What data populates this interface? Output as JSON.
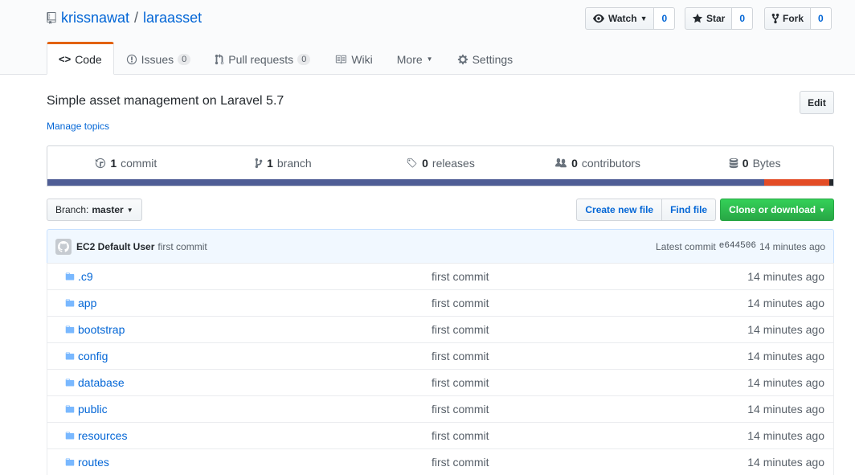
{
  "repo": {
    "owner": "krissnawat",
    "separator": "/",
    "name": "laraasset"
  },
  "actions": {
    "watch": {
      "label": "Watch",
      "count": "0"
    },
    "star": {
      "label": "Star",
      "count": "0"
    },
    "fork": {
      "label": "Fork",
      "count": "0"
    }
  },
  "nav": {
    "code": "Code",
    "issues": "Issues",
    "issues_count": "0",
    "pulls": "Pull requests",
    "pulls_count": "0",
    "wiki": "Wiki",
    "more": "More",
    "settings": "Settings"
  },
  "description": "Simple asset management on Laravel 5.7",
  "manage_topics": "Manage topics",
  "edit_label": "Edit",
  "summary": {
    "commits_n": "1",
    "commits_label": "commit",
    "branches_n": "1",
    "branches_label": "branch",
    "releases_n": "0",
    "releases_label": "releases",
    "contributors_n": "0",
    "contributors_label": "contributors",
    "size_n": "0",
    "size_label": "Bytes"
  },
  "language_bar": [
    {
      "color": "#4F5D95",
      "fraction": 0.912
    },
    {
      "color": "#e34c26",
      "fraction": 0.083
    },
    {
      "color": "#24292e",
      "fraction": 0.005
    }
  ],
  "branch": {
    "prefix": "Branch:",
    "name": "master"
  },
  "file_buttons": {
    "create": "Create new file",
    "find": "Find file",
    "clone": "Clone or download"
  },
  "latest_commit": {
    "author": "EC2 Default User",
    "message": "first commit",
    "prefix": "Latest commit",
    "sha": "e644506",
    "age": "14 minutes ago"
  },
  "files": [
    {
      "name": ".c9",
      "message": "first commit",
      "age": "14 minutes ago"
    },
    {
      "name": "app",
      "message": "first commit",
      "age": "14 minutes ago"
    },
    {
      "name": "bootstrap",
      "message": "first commit",
      "age": "14 minutes ago"
    },
    {
      "name": "config",
      "message": "first commit",
      "age": "14 minutes ago"
    },
    {
      "name": "database",
      "message": "first commit",
      "age": "14 minutes ago"
    },
    {
      "name": "public",
      "message": "first commit",
      "age": "14 minutes ago"
    },
    {
      "name": "resources",
      "message": "first commit",
      "age": "14 minutes ago"
    },
    {
      "name": "routes",
      "message": "first commit",
      "age": "14 minutes ago"
    }
  ]
}
